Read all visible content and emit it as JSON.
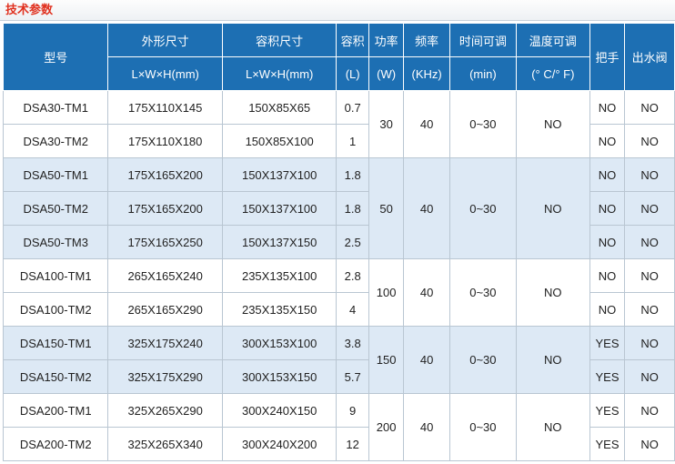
{
  "title": "技术参数",
  "headers": {
    "model": "型号",
    "outer": "外形尺寸",
    "inner": "容积尺寸",
    "volume": "容积",
    "power": "功率",
    "freq": "频率",
    "time": "时间可调",
    "temp": "温度可调",
    "handle": "把手",
    "valve": "出水阀",
    "outer_unit": "L×W×H(mm)",
    "inner_unit": "L×W×H(mm)",
    "volume_unit": "(L)",
    "power_unit": "(W)",
    "freq_unit": "(KHz)",
    "time_unit": "(min)",
    "temp_unit": "(° C/° F)"
  },
  "groups": [
    {
      "power": "30",
      "freq": "40",
      "time": "0~30",
      "temp": "NO",
      "rows": [
        {
          "model": "DSA30-TM1",
          "outer": "175X110X145",
          "inner": "150X85X65",
          "vol": "0.7",
          "handle": "NO",
          "valve": "NO"
        },
        {
          "model": "DSA30-TM2",
          "outer": "175X110X180",
          "inner": "150X85X100",
          "vol": "1",
          "handle": "NO",
          "valve": "NO"
        }
      ]
    },
    {
      "power": "50",
      "freq": "40",
      "time": "0~30",
      "temp": "NO",
      "rows": [
        {
          "model": "DSA50-TM1",
          "outer": "175X165X200",
          "inner": "150X137X100",
          "vol": "1.8",
          "handle": "NO",
          "valve": "NO"
        },
        {
          "model": "DSA50-TM2",
          "outer": "175X165X200",
          "inner": "150X137X100",
          "vol": "1.8",
          "handle": "NO",
          "valve": "NO"
        },
        {
          "model": "DSA50-TM3",
          "outer": "175X165X250",
          "inner": "150X137X150",
          "vol": "2.5",
          "handle": "NO",
          "valve": "NO"
        }
      ]
    },
    {
      "power": "100",
      "freq": "40",
      "time": "0~30",
      "temp": "NO",
      "rows": [
        {
          "model": "DSA100-TM1",
          "outer": "265X165X240",
          "inner": "235X135X100",
          "vol": "2.8",
          "handle": "NO",
          "valve": "NO"
        },
        {
          "model": "DSA100-TM2",
          "outer": "265X165X290",
          "inner": "235X135X150",
          "vol": "4",
          "handle": "NO",
          "valve": "NO"
        }
      ]
    },
    {
      "power": "150",
      "freq": "40",
      "time": "0~30",
      "temp": "NO",
      "rows": [
        {
          "model": "DSA150-TM1",
          "outer": "325X175X240",
          "inner": "300X153X100",
          "vol": "3.8",
          "handle": "YES",
          "valve": "NO"
        },
        {
          "model": "DSA150-TM2",
          "outer": "325X175X290",
          "inner": "300X153X150",
          "vol": "5.7",
          "handle": "YES",
          "valve": "NO"
        }
      ]
    },
    {
      "power": "200",
      "freq": "40",
      "time": "0~30",
      "temp": "NO",
      "rows": [
        {
          "model": "DSA200-TM1",
          "outer": "325X265X290",
          "inner": "300X240X150",
          "vol": "9",
          "handle": "YES",
          "valve": "NO"
        },
        {
          "model": "DSA200-TM2",
          "outer": "325X265X340",
          "inner": "300X240X200",
          "vol": "12",
          "handle": "YES",
          "valve": "NO"
        }
      ]
    }
  ]
}
